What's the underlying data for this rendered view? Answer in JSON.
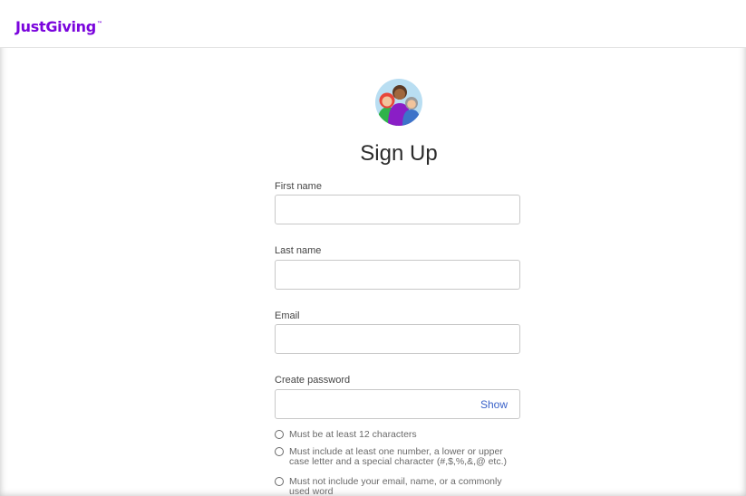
{
  "header": {
    "logo_text": "JustGiving",
    "logo_mark": "™",
    "brand_color": "#7a04dd"
  },
  "form": {
    "avatar_icon": "people-group-icon",
    "title": "Sign Up",
    "fields": {
      "first_name": {
        "label": "First name",
        "value": "",
        "placeholder": ""
      },
      "last_name": {
        "label": "Last name",
        "value": "",
        "placeholder": ""
      },
      "email": {
        "label": "Email",
        "value": "",
        "placeholder": ""
      },
      "password": {
        "label": "Create password",
        "value": "",
        "placeholder": "",
        "show_label": "Show"
      }
    },
    "password_rules": [
      "Must be at least 12 characters",
      "Must include at least one number, a lower or upper case letter and a special character (#,$,%,&,@ etc.)",
      "Must not include your email, name, or a commonly used word"
    ],
    "link_color": "#3a62c9"
  }
}
